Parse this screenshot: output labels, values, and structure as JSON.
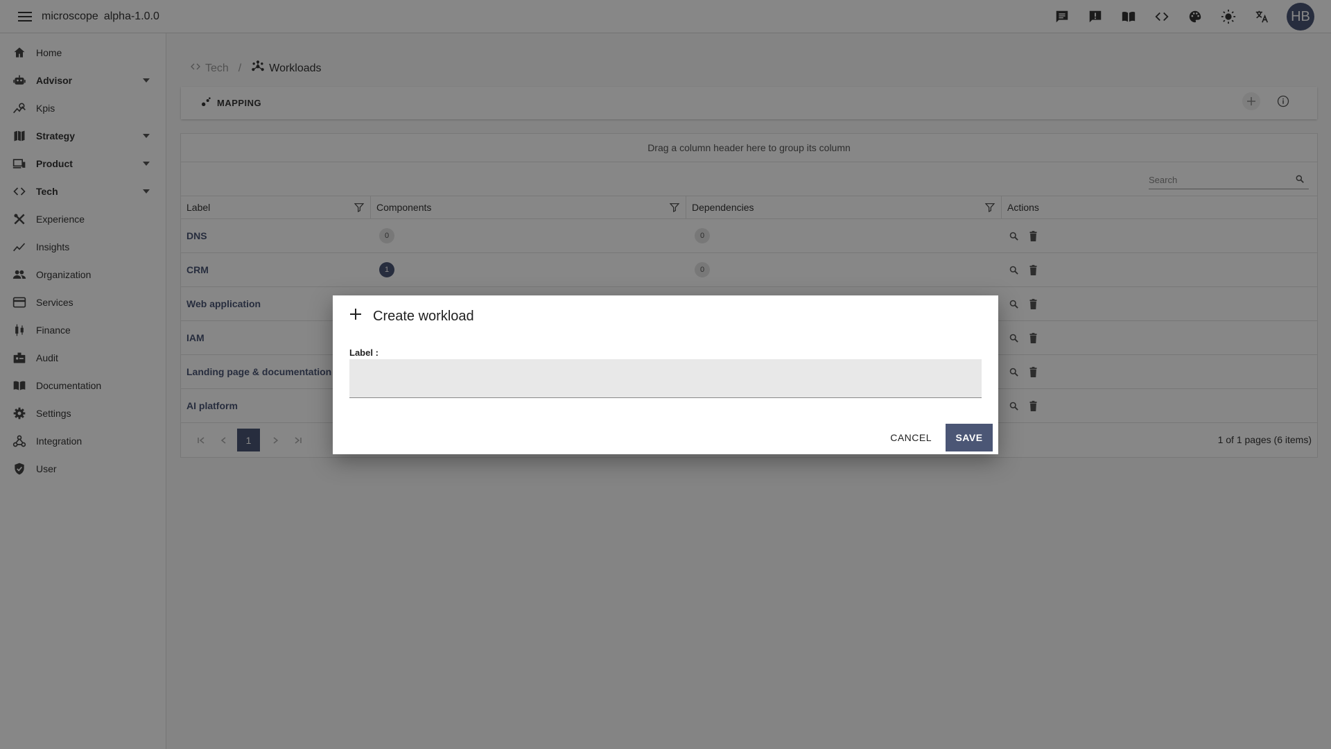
{
  "app": {
    "name": "microscope",
    "version": "alpha-1.0.0",
    "avatar_initials": "HB"
  },
  "topbar_icons": [
    "chat-icon",
    "feedback-icon",
    "book-icon",
    "code-icon",
    "palette-icon",
    "brightness-icon",
    "translate-icon"
  ],
  "sidebar": {
    "items": [
      {
        "label": "Home",
        "icon": "home-icon",
        "expandable": false
      },
      {
        "label": "Advisor",
        "icon": "robot-icon",
        "expandable": true
      },
      {
        "label": "Kpis",
        "icon": "chart-icon",
        "expandable": false
      },
      {
        "label": "Strategy",
        "icon": "map-icon",
        "expandable": true
      },
      {
        "label": "Product",
        "icon": "devices-icon",
        "expandable": true
      },
      {
        "label": "Tech",
        "icon": "code-icon",
        "expandable": true
      },
      {
        "label": "Experience",
        "icon": "design-icon",
        "expandable": false
      },
      {
        "label": "Insights",
        "icon": "trend-icon",
        "expandable": false
      },
      {
        "label": "Organization",
        "icon": "people-icon",
        "expandable": false
      },
      {
        "label": "Services",
        "icon": "card-icon",
        "expandable": false
      },
      {
        "label": "Finance",
        "icon": "candlestick-icon",
        "expandable": false
      },
      {
        "label": "Audit",
        "icon": "badge-icon",
        "expandable": false
      },
      {
        "label": "Documentation",
        "icon": "book-icon",
        "expandable": false
      },
      {
        "label": "Settings",
        "icon": "gear-icon",
        "expandable": false
      },
      {
        "label": "Integration",
        "icon": "hub-icon",
        "expandable": false
      },
      {
        "label": "User",
        "icon": "shield-icon",
        "expandable": false
      }
    ]
  },
  "breadcrumb": {
    "parent": "Tech",
    "separator": "/",
    "current": "Workloads"
  },
  "toolbar": {
    "tab_label": "MAPPING"
  },
  "grid": {
    "group_hint": "Drag a column header here to group its column",
    "search_placeholder": "Search",
    "columns": [
      "Label",
      "Components",
      "Dependencies",
      "Actions"
    ],
    "rows": [
      {
        "label": "DNS",
        "components": "0",
        "dependencies": "0"
      },
      {
        "label": "CRM",
        "components": "1",
        "dependencies": "0"
      },
      {
        "label": "Web application",
        "components": "",
        "dependencies": ""
      },
      {
        "label": "IAM",
        "components": "",
        "dependencies": ""
      },
      {
        "label": "Landing page & documentation website",
        "components": "",
        "dependencies": ""
      },
      {
        "label": "AI platform",
        "components": "",
        "dependencies": ""
      }
    ],
    "pager": {
      "current_page": "1",
      "info": "1 of 1 pages (6 items)"
    }
  },
  "dialog": {
    "title": "Create workload",
    "field_label": "Label :",
    "field_value": "",
    "cancel_label": "CANCEL",
    "save_label": "SAVE"
  },
  "colors": {
    "primary": "#4b5675",
    "overlay": "rgba(0,0,0,0.47)"
  }
}
